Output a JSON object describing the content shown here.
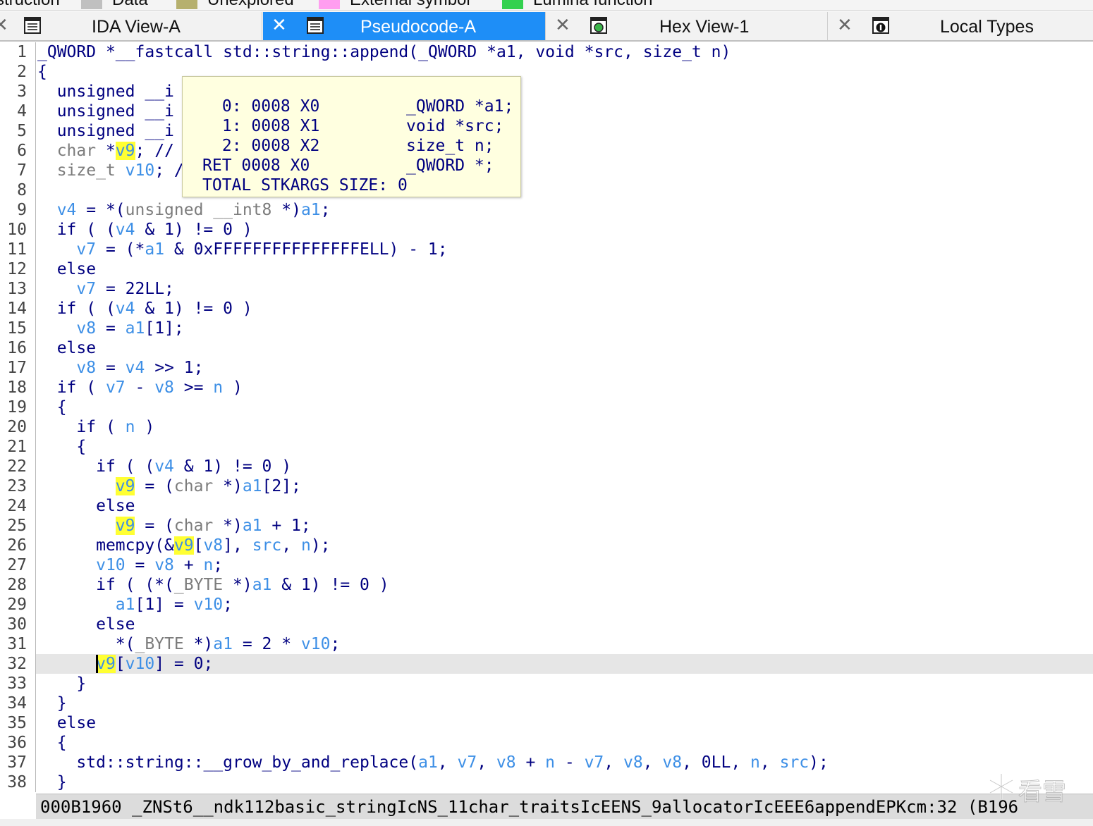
{
  "legend": [
    {
      "label": "struction",
      "color": ""
    },
    {
      "label": "Data",
      "color": "#c0c0c0"
    },
    {
      "label": "Unexplored",
      "color": "#b6b06e"
    },
    {
      "label": "External symbol",
      "color": "#ff9ef0"
    },
    {
      "label": "Lumina function",
      "color": "#33d14f"
    }
  ],
  "tabs": [
    {
      "label": "IDA View-A",
      "icon": "list-view-icon",
      "active": false
    },
    {
      "label": "Pseudocode-A",
      "icon": "list-view-icon",
      "active": true
    },
    {
      "label": "Hex View-1",
      "icon": "hex-view-icon",
      "active": false
    },
    {
      "label": "Local Types",
      "icon": "local-types-icon",
      "active": false
    }
  ],
  "code": {
    "current_line": 32,
    "highlight_color": "#ffff33",
    "line_numbers": [
      "1",
      "2",
      "3",
      "4",
      "5",
      "6",
      "7",
      "8",
      "9",
      "10",
      "11",
      "12",
      "13",
      "14",
      "15",
      "16",
      "17",
      "18",
      "19",
      "20",
      "21",
      "22",
      "23",
      "24",
      "25",
      "26",
      "27",
      "28",
      "29",
      "30",
      "31",
      "32",
      "33",
      "34",
      "35",
      "36",
      "37",
      "38"
    ],
    "lines": [
      "_QWORD *__fastcall std::string::append(_QWORD *a1, void *src, size_t n)",
      "{",
      "  unsigned __i",
      "  unsigned __i",
      "  unsigned __i",
      "  char *v9; //",
      "  size_t v10; /",
      "",
      "  v4 = *(unsigned __int8 *)a1;",
      "  if ( (v4 & 1) != 0 )",
      "    v7 = (*a1 & 0xFFFFFFFFFFFFFFFELL) - 1;",
      "  else",
      "    v7 = 22LL;",
      "  if ( (v4 & 1) != 0 )",
      "    v8 = a1[1];",
      "  else",
      "    v8 = v4 >> 1;",
      "  if ( v7 - v8 >= n )",
      "  {",
      "    if ( n )",
      "    {",
      "      if ( (v4 & 1) != 0 )",
      "        v9 = (char *)a1[2];",
      "      else",
      "        v9 = (char *)a1 + 1;",
      "      memcpy(&v9[v8], src, n);",
      "      v10 = v8 + n;",
      "      if ( (*(_BYTE *)a1 & 1) != 0 )",
      "        a1[1] = v10;",
      "      else",
      "        *(_BYTE *)a1 = 2 * v10;",
      "      v9[v10] = 0;",
      "    }",
      "  }",
      "  else",
      "  {",
      "    std::string::__grow_by_and_replace(a1, v7, v8 + n - v7, v8, v8, 0LL, n, src);",
      "  }"
    ]
  },
  "tooltip": {
    "rows": [
      {
        "slot": " 0: 0008 X0",
        "decl": "_QWORD *a1;"
      },
      {
        "slot": " 1: 0008 X1",
        "decl": "void *src;"
      },
      {
        "slot": " 2: 0008 X2",
        "decl": "size_t n;"
      },
      {
        "slot": "RET 0008 X0",
        "decl": "_QWORD *;"
      }
    ],
    "total": "TOTAL STKARGS SIZE: 0"
  },
  "status_bar": {
    "text": "000B1960 _ZNSt6__ndk112basic_stringIcNS_11char_traitsIcEENS_9allocatorIcEEE6appendEPKcm:32 (B196"
  },
  "watermark": {
    "text": "看雪"
  }
}
